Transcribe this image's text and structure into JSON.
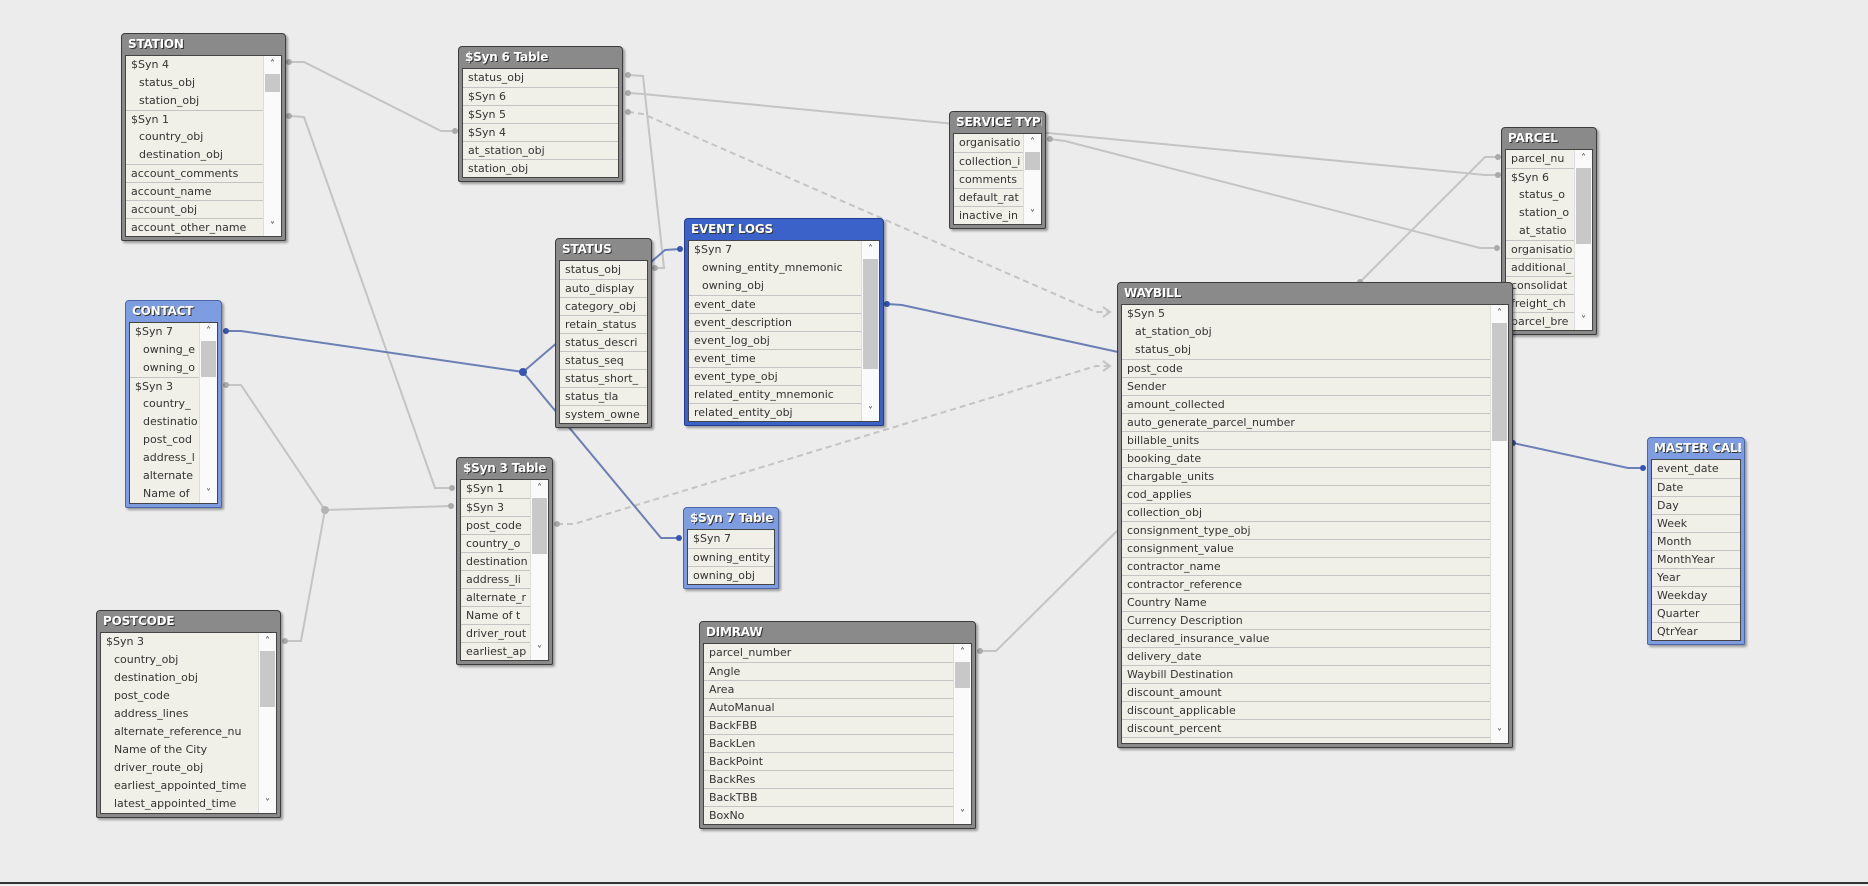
{
  "colors": {
    "background": "#ececec",
    "title_gray": "#8a8a8a",
    "title_blue": "#7d9de0",
    "title_selected": "#3a62c8",
    "link_gray": "#c4c4c4",
    "link_blue": "#6b7fb5",
    "row_bg": "#f0f0e8"
  },
  "scroll_icons": {
    "up": "chevron-up-icon",
    "down": "chevron-down-icon"
  },
  "tables": [
    {
      "id": "station",
      "title": "STATION",
      "style": "gray",
      "scroll": true,
      "fields": [
        {
          "label": "$Syn 4"
        },
        {
          "label": "status_obj",
          "sub": true
        },
        {
          "label": "station_obj",
          "sub": true
        },
        {
          "label": "$Syn 1"
        },
        {
          "label": "country_obj",
          "sub": true
        },
        {
          "label": "destination_obj",
          "sub": true
        },
        {
          "label": "account_comments"
        },
        {
          "label": "account_name"
        },
        {
          "label": "account_obj"
        },
        {
          "label": "account_other_name"
        }
      ]
    },
    {
      "id": "syn6",
      "title": "$Syn 6 Table",
      "style": "gray",
      "scroll": false,
      "fields": [
        {
          "label": "status_obj"
        },
        {
          "label": "$Syn 6"
        },
        {
          "label": "$Syn 5"
        },
        {
          "label": "$Syn 4"
        },
        {
          "label": "at_station_obj"
        },
        {
          "label": "station_obj"
        }
      ]
    },
    {
      "id": "status",
      "title": "STATUS",
      "style": "gray",
      "scroll": false,
      "fields": [
        {
          "label": "status_obj"
        },
        {
          "label": "auto_display"
        },
        {
          "label": "category_obj"
        },
        {
          "label": "retain_status"
        },
        {
          "label": "status_descri"
        },
        {
          "label": "status_seq"
        },
        {
          "label": "status_short_"
        },
        {
          "label": "status_tla"
        },
        {
          "label": "system_owne"
        }
      ]
    },
    {
      "id": "eventlogs",
      "title": "EVENT LOGS",
      "style": "selected",
      "scroll": true,
      "fields": [
        {
          "label": "$Syn 7"
        },
        {
          "label": "owning_entity_mnemonic",
          "sub": true
        },
        {
          "label": "owning_obj",
          "sub": true
        },
        {
          "label": "event_date"
        },
        {
          "label": "event_description"
        },
        {
          "label": "event_log_obj"
        },
        {
          "label": "event_time"
        },
        {
          "label": "event_type_obj"
        },
        {
          "label": "related_entity_mnemonic"
        },
        {
          "label": "related_entity_obj"
        }
      ]
    },
    {
      "id": "contact",
      "title": "CONTACT",
      "style": "blue",
      "scroll": true,
      "fields": [
        {
          "label": "$Syn 7"
        },
        {
          "label": "owning_e",
          "sub": true
        },
        {
          "label": "owning_o",
          "sub": true
        },
        {
          "label": "$Syn 3"
        },
        {
          "label": "country_",
          "sub": true
        },
        {
          "label": "destinatio",
          "sub": true
        },
        {
          "label": "post_cod",
          "sub": true
        },
        {
          "label": "address_l",
          "sub": true
        },
        {
          "label": "alternate",
          "sub": true
        },
        {
          "label": "Name of",
          "sub": true
        }
      ]
    },
    {
      "id": "syn3",
      "title": "$Syn 3 Table",
      "style": "gray",
      "scroll": true,
      "fields": [
        {
          "label": "$Syn 1"
        },
        {
          "label": "$Syn 3"
        },
        {
          "label": "post_code"
        },
        {
          "label": "country_o"
        },
        {
          "label": "destination"
        },
        {
          "label": "address_li"
        },
        {
          "label": "alternate_r"
        },
        {
          "label": "Name of t"
        },
        {
          "label": "driver_rout"
        },
        {
          "label": "earliest_ap"
        }
      ]
    },
    {
      "id": "postcode",
      "title": "POSTCODE",
      "style": "gray",
      "scroll": true,
      "fields": [
        {
          "label": "$Syn 3"
        },
        {
          "label": "country_obj",
          "sub": true
        },
        {
          "label": "destination_obj",
          "sub": true
        },
        {
          "label": "post_code",
          "sub": true
        },
        {
          "label": "address_lines",
          "sub": true
        },
        {
          "label": "alternate_reference_nu",
          "sub": true
        },
        {
          "label": "Name of the City",
          "sub": true
        },
        {
          "label": "driver_route_obj",
          "sub": true
        },
        {
          "label": "earliest_appointed_time",
          "sub": true
        },
        {
          "label": "latest_appointed_time",
          "sub": true
        }
      ]
    },
    {
      "id": "servicetype",
      "title": "SERVICE TYPE",
      "style": "gray",
      "scroll": true,
      "fields": [
        {
          "label": "organisatio"
        },
        {
          "label": "collection_i"
        },
        {
          "label": "comments"
        },
        {
          "label": "default_rat"
        },
        {
          "label": "inactive_in"
        }
      ]
    },
    {
      "id": "parcel",
      "title": "PARCEL",
      "style": "gray",
      "scroll": true,
      "fields": [
        {
          "label": "parcel_nu"
        },
        {
          "label": "$Syn 6"
        },
        {
          "label": "status_o",
          "sub": true
        },
        {
          "label": "station_o",
          "sub": true
        },
        {
          "label": "at_statio",
          "sub": true
        },
        {
          "label": "organisatio"
        },
        {
          "label": "additional_"
        },
        {
          "label": "consolidat"
        },
        {
          "label": "freight_ch"
        },
        {
          "label": "parcel_bre"
        }
      ]
    },
    {
      "id": "waybill",
      "title": "WAYBILL",
      "style": "gray",
      "scroll": true,
      "fields": [
        {
          "label": "$Syn 5"
        },
        {
          "label": "at_station_obj",
          "sub": true
        },
        {
          "label": "status_obj",
          "sub": true
        },
        {
          "label": "post_code"
        },
        {
          "label": "Sender"
        },
        {
          "label": "amount_collected"
        },
        {
          "label": "auto_generate_parcel_number"
        },
        {
          "label": "billable_units"
        },
        {
          "label": "booking_date"
        },
        {
          "label": "chargable_units"
        },
        {
          "label": "cod_applies"
        },
        {
          "label": "collection_obj"
        },
        {
          "label": "consignment_type_obj"
        },
        {
          "label": "consignment_value"
        },
        {
          "label": "contractor_name"
        },
        {
          "label": "contractor_reference"
        },
        {
          "label": "Country Name"
        },
        {
          "label": "Currency Description"
        },
        {
          "label": "declared_insurance_value"
        },
        {
          "label": "delivery_date"
        },
        {
          "label": "Waybill Destination"
        },
        {
          "label": "discount_amount"
        },
        {
          "label": "discount_applicable"
        },
        {
          "label": "discount_percent"
        },
        {
          "label": ""
        }
      ]
    },
    {
      "id": "mastercal",
      "title": "MASTER CALE",
      "style": "blue",
      "scroll": false,
      "fields": [
        {
          "label": "event_date"
        },
        {
          "label": "Date"
        },
        {
          "label": "Day"
        },
        {
          "label": "Week"
        },
        {
          "label": "Month"
        },
        {
          "label": "MonthYear"
        },
        {
          "label": "Year"
        },
        {
          "label": "Weekday"
        },
        {
          "label": "Quarter"
        },
        {
          "label": "QtrYear"
        }
      ]
    },
    {
      "id": "syn7",
      "title": "$Syn 7 Table",
      "style": "blue",
      "scroll": false,
      "fields": [
        {
          "label": "$Syn 7"
        },
        {
          "label": "owning_entity"
        },
        {
          "label": "owning_obj"
        }
      ]
    },
    {
      "id": "dimraw",
      "title": "DIMRAW",
      "style": "gray",
      "scroll": true,
      "fields": [
        {
          "label": "parcel_number"
        },
        {
          "label": "Angle"
        },
        {
          "label": "Area"
        },
        {
          "label": "AutoManual"
        },
        {
          "label": "BackFBB"
        },
        {
          "label": "BackLen"
        },
        {
          "label": "BackPoint"
        },
        {
          "label": "BackRes"
        },
        {
          "label": "BackTBB"
        },
        {
          "label": "BoxNo"
        }
      ]
    }
  ],
  "links": [
    {
      "from": "STATION.$Syn 4",
      "to": "$Syn 6 Table.$Syn 4",
      "kind": "gray"
    },
    {
      "from": "STATION.$Syn 1",
      "to": "$Syn 3 Table.$Syn 1",
      "kind": "gray"
    },
    {
      "from": "$Syn 6 Table.status_obj",
      "to": "STATUS.status_obj",
      "kind": "gray"
    },
    {
      "from": "$Syn 6 Table.$Syn 6",
      "to": "PARCEL.$Syn 6",
      "kind": "gray"
    },
    {
      "from": "SERVICE TYPE.organisatio",
      "to": "PARCEL.organisatio",
      "kind": "gray"
    },
    {
      "from": "$Syn 6 Table.$Syn 5",
      "to": "WAYBILL.$Syn 5",
      "kind": "dashed"
    },
    {
      "from": "$Syn 3 Table.post_code",
      "to": "WAYBILL.post_code",
      "kind": "dashed"
    },
    {
      "from": "CONTACT.$Syn 3",
      "to": "$Syn 3 Table.$Syn 3",
      "kind": "gray"
    },
    {
      "from": "POSTCODE.$Syn 3",
      "to": "$Syn 3 Table.$Syn 3",
      "kind": "gray"
    },
    {
      "from": "DIMRAW.parcel_number",
      "to": "WAYBILL",
      "kind": "gray"
    },
    {
      "from": "WAYBILL",
      "to": "PARCEL.parcel_nu",
      "kind": "gray"
    },
    {
      "from": "CONTACT.$Syn 7",
      "to": "EVENT LOGS.$Syn 7",
      "kind": "blue"
    },
    {
      "from": "CONTACT.$Syn 7",
      "to": "$Syn 7 Table.$Syn 7",
      "kind": "blue"
    },
    {
      "from": "EVENT LOGS.event_date",
      "to": "WAYBILL",
      "kind": "blue"
    },
    {
      "from": "WAYBILL",
      "to": "MASTER CALE.event_date",
      "kind": "blue"
    }
  ]
}
